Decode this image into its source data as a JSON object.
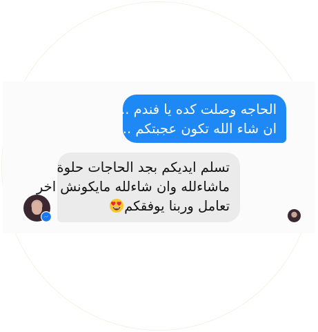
{
  "conversation": {
    "sent_message": {
      "lines": [
        "الحاجه وصلت كده يا فندم ..",
        "ان شاء الله تكون عجبتكم .."
      ]
    },
    "received_message": {
      "lines": [
        "تسلم ايديكم بجد الحاجات حلوة",
        "ماشاءلله وان شاءلله مايكونش اخر",
        "تعامل وربنا يوفقكم"
      ],
      "trailing_emoji": "heart-eyes-emoji"
    },
    "contact_avatar": {
      "badge_icon": "messenger-icon"
    },
    "read_receipt": {
      "icon": "avatar-read-receipt"
    }
  },
  "colors": {
    "sent_bubble": "#1e88f5",
    "received_bubble": "#ebebeb",
    "messenger_badge": "#1877f2"
  }
}
